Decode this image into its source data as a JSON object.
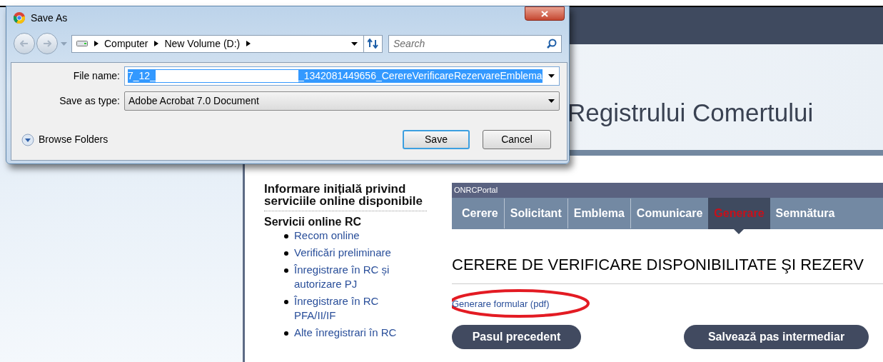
{
  "dialog": {
    "title": "Save As",
    "address_path": [
      "Computer",
      "New Volume (D:)"
    ],
    "search": {
      "placeholder": "Search"
    },
    "file_name": {
      "label": "File name:",
      "value_start": "7_12_",
      "value_end": "_1342081449656_CerereVerificareRezervareEmblema"
    },
    "save_as_type": {
      "label": "Save as type:",
      "value": "Adobe Acrobat 7.0 Document"
    },
    "browse_folders": "Browse Folders",
    "buttons": [
      {
        "label": "Save",
        "default": true
      },
      {
        "label": "Cancel",
        "default": false
      }
    ]
  },
  "page": {
    "banner_title": "Registrului Comertului",
    "sidebar": {
      "heading": "Informare inițială privind serviciile online disponibile",
      "section": "Servicii online RC",
      "links": [
        "Recom online",
        "Verificări preliminare",
        "Înregistrare în RC și autorizare PJ",
        "Înregistrare în RC PFA/II/IF",
        "Alte înregistrari în RC"
      ]
    },
    "portal": {
      "title": "ONRCPortal",
      "tabs": [
        {
          "label": "Cerere",
          "selected": false
        },
        {
          "label": "Solicitant",
          "selected": false
        },
        {
          "label": "Emblema",
          "selected": false
        },
        {
          "label": "Comunicare",
          "selected": false
        },
        {
          "label": "Generare",
          "selected": true
        },
        {
          "label": "Semnătura",
          "selected": false
        }
      ],
      "heading": "CERERE DE VERIFICARE DISPONIBILITATE ŞI REZERV",
      "link": "Generare formular (pdf)",
      "buttons": [
        "Pasul precedent",
        "Salvează pas intermediar"
      ]
    }
  }
}
